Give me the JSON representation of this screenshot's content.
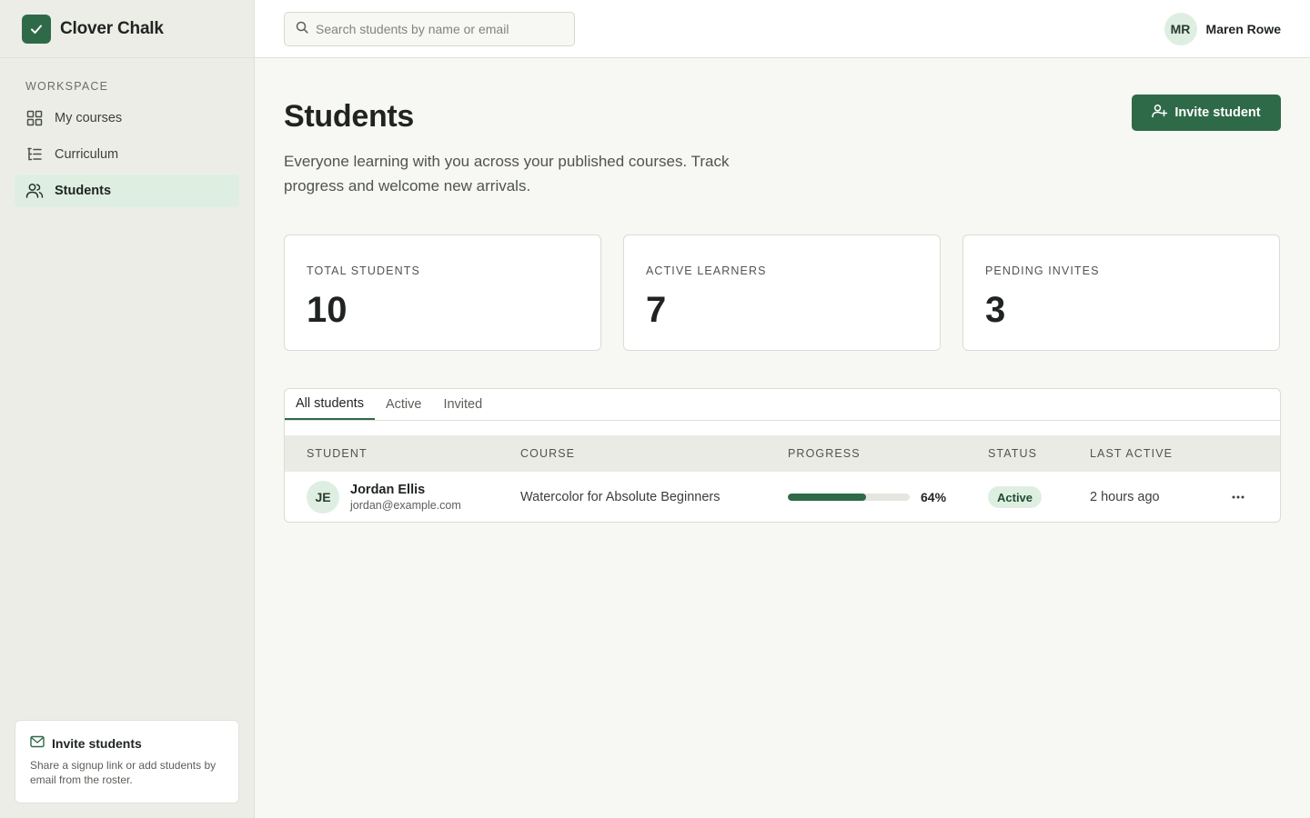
{
  "brand": {
    "name": "Clover Chalk",
    "icon": "check-icon"
  },
  "sidebar": {
    "section_heading": "WORKSPACE",
    "items": [
      {
        "label": "My courses",
        "icon": "grid-icon",
        "active": false
      },
      {
        "label": "Curriculum",
        "icon": "list-icon",
        "active": false
      },
      {
        "label": "Students",
        "icon": "users-icon",
        "active": true
      }
    ],
    "invite_card": {
      "title": "Invite students",
      "text": "Share a signup link or add students by email from the roster.",
      "icon": "mail-icon"
    }
  },
  "topbar": {
    "search_placeholder": "Search students by name or email",
    "user": {
      "initials": "MR",
      "name": "Maren Rowe"
    }
  },
  "page": {
    "title": "Students",
    "description": "Everyone learning with you across your published courses. Track progress and welcome new arrivals.",
    "invite_button": "Invite student"
  },
  "stats": [
    {
      "label": "TOTAL STUDENTS",
      "value": "10"
    },
    {
      "label": "ACTIVE LEARNERS",
      "value": "7"
    },
    {
      "label": "PENDING INVITES",
      "value": "3"
    }
  ],
  "tabs": [
    {
      "label": "All students",
      "active": true
    },
    {
      "label": "Active",
      "active": false
    },
    {
      "label": "Invited",
      "active": false
    }
  ],
  "table": {
    "columns": [
      "STUDENT",
      "COURSE",
      "PROGRESS",
      "STATUS",
      "LAST ACTIVE"
    ],
    "rows": [
      {
        "initials": "JE",
        "name": "Jordan Ellis",
        "email": "jordan@example.com",
        "course": "Watercolor for Absolute Beginners",
        "progress": 0.64,
        "progress_label": "64%",
        "status": "Active",
        "last_active": "2 hours ago"
      }
    ]
  },
  "colors": {
    "accent": "#2f6a48",
    "accent_soft": "#deefe2",
    "background": "#f7f7f3"
  }
}
